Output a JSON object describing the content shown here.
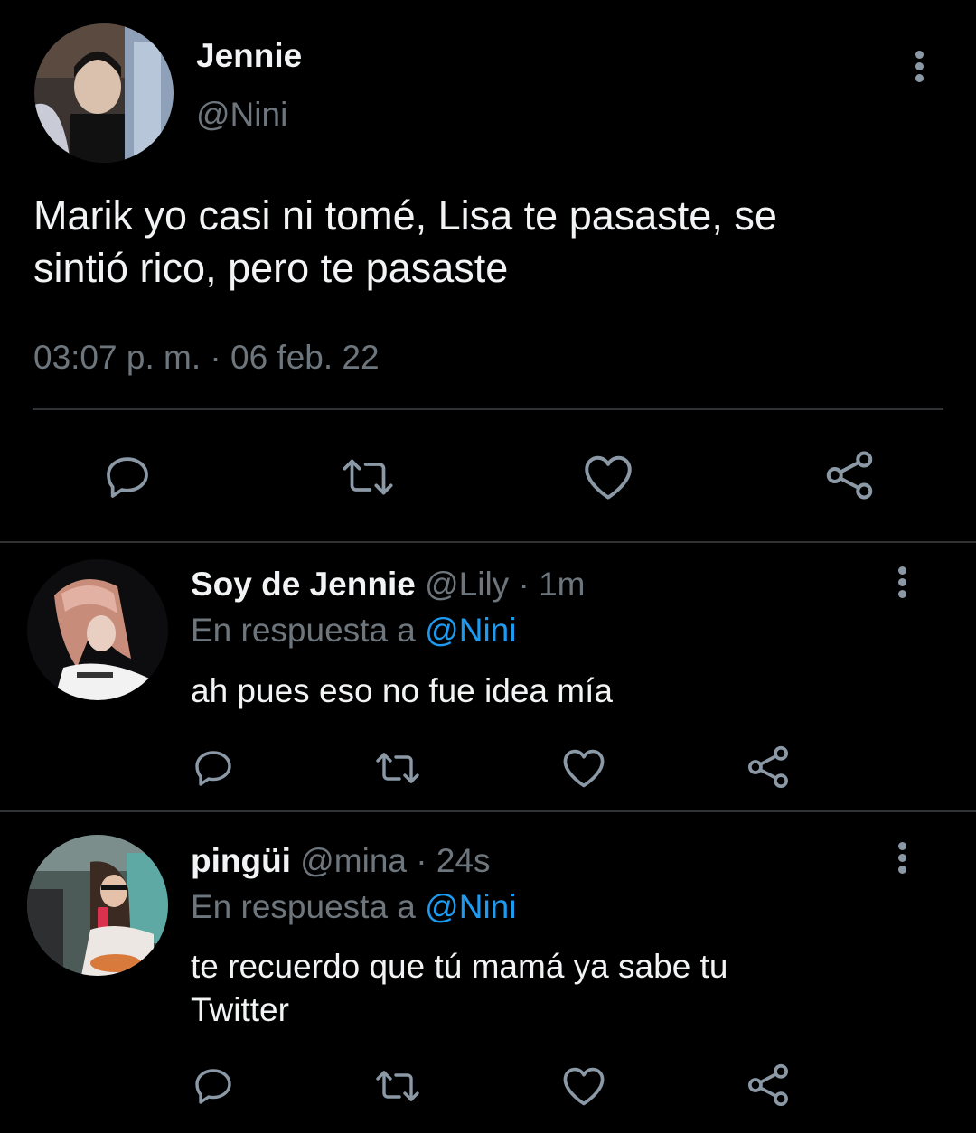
{
  "main_tweet": {
    "author_name": "Jennie",
    "author_handle": "@Nini",
    "text_line1": "Marik yo casi ni tomé, Lisa te pasaste, se",
    "text_line2": "sintió rico, pero te pasaste",
    "timestamp": "03:07 p. m. · 06 feb. 22"
  },
  "replies": [
    {
      "author_name": "Soy de Jennie",
      "author_handle": "@Lily",
      "separator": "·",
      "time": "1m",
      "reply_prefix": "En respuesta a",
      "reply_to": "@Nini",
      "text_line1": "ah pues eso no fue idea mía",
      "text_line2": ""
    },
    {
      "author_name": "pingüi",
      "author_handle": "@mina",
      "separator": "·",
      "time": "24s",
      "reply_prefix": "En respuesta a",
      "reply_to": "@Nini",
      "text_line1": "te recuerdo que tú mamá ya sabe tu",
      "text_line2": "Twitter"
    }
  ],
  "icons": {
    "reply": "reply-icon",
    "retweet": "retweet-icon",
    "like": "heart-icon",
    "share": "share-icon",
    "more": "more-options-icon"
  },
  "colors": {
    "background": "#000000",
    "text": "#e7e9ea",
    "muted": "#6e767d",
    "link": "#1d9bf0",
    "divider": "#2f3336",
    "icon": "#8b98a5"
  }
}
